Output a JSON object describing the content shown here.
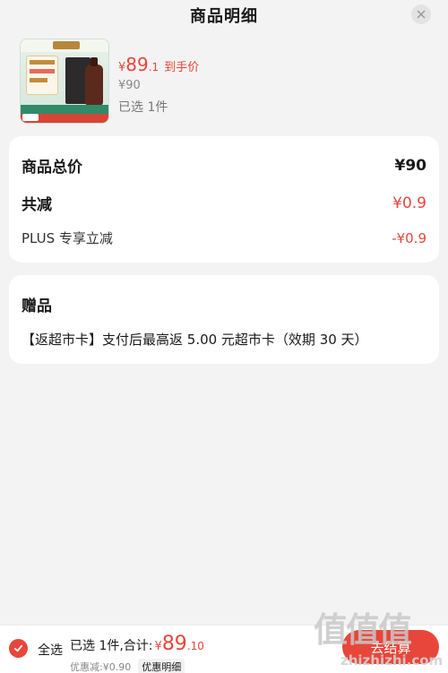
{
  "header": {
    "title": "商品明细"
  },
  "product": {
    "price_currency": "¥",
    "price_int": "89",
    "price_dec": ".1",
    "price_label": "到手价",
    "original_price": "¥90",
    "selected_text": "已选 1件"
  },
  "summary": {
    "total_label": "商品总价",
    "total_value": "¥90",
    "reduce_label": "共减",
    "reduce_value": "¥0.9",
    "plus_label": "PLUS 专享立减",
    "plus_value": "-¥0.9"
  },
  "gift": {
    "title": "赠品",
    "item": "【返超市卡】支付后最高返 5.00 元超市卡（效期 30 天）"
  },
  "footer": {
    "select_all": "全选",
    "total_prefix": "已选 1件,合计:",
    "total_currency": "¥",
    "total_int": "89",
    "total_dec": ".10",
    "discount_text": "优惠减:¥0.90",
    "detail_label": "优惠明细",
    "checkout_label": "去结算"
  },
  "colors": {
    "accent": "#e8463a",
    "background": "#f3f3f3"
  },
  "watermark": {
    "text": "值值值",
    "url": "zhizhizhi.com"
  }
}
